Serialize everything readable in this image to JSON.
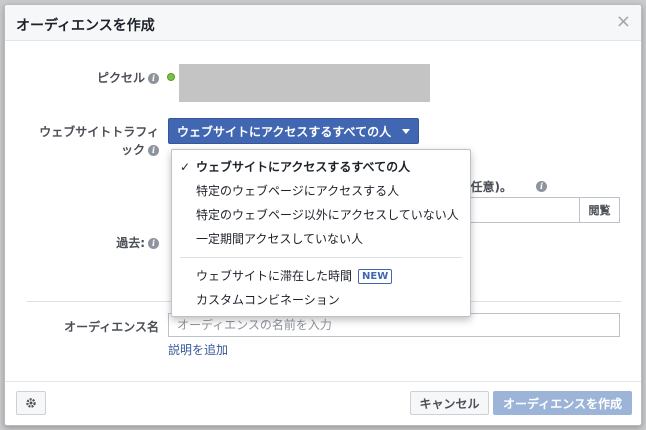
{
  "dialog": {
    "title": "オーディエンスを作成",
    "close_icon": "×"
  },
  "form": {
    "pixel_label": "ピクセル",
    "traffic_label_line1": "ウェブサイトトラフィ",
    "traffic_label_line2": "ック",
    "traffic_selected": "ウェブサイトにアクセスするすべての人",
    "past_label": "過去:",
    "hidden_row_text": "(任意)。",
    "browse_label": "閲覧",
    "audience_name_label": "オーディエンス名",
    "audience_name_value": "",
    "audience_name_placeholder": "オーディエンスの名前を入力",
    "add_description": "説明を追加"
  },
  "dropdown": {
    "items": [
      {
        "label": "ウェブサイトにアクセスするすべての人",
        "selected": true
      },
      {
        "label": "特定のウェブページにアクセスする人"
      },
      {
        "label": "特定のウェブページ以外にアクセスしていない人"
      },
      {
        "label": "一定期間アクセスしていない人"
      }
    ],
    "items2": [
      {
        "label": "ウェブサイトに滞在した時間",
        "badge": "NEW"
      },
      {
        "label": "カスタムコンビネーション"
      }
    ]
  },
  "footer": {
    "cancel": "キャンセル",
    "create": "オーディエンスを作成"
  },
  "icons": {
    "info": "i",
    "check": "✓"
  },
  "colors": {
    "primary": "#4267b2",
    "primary_disabled": "#9cb4d8",
    "status_green": "#7ac142",
    "link": "#365899"
  }
}
